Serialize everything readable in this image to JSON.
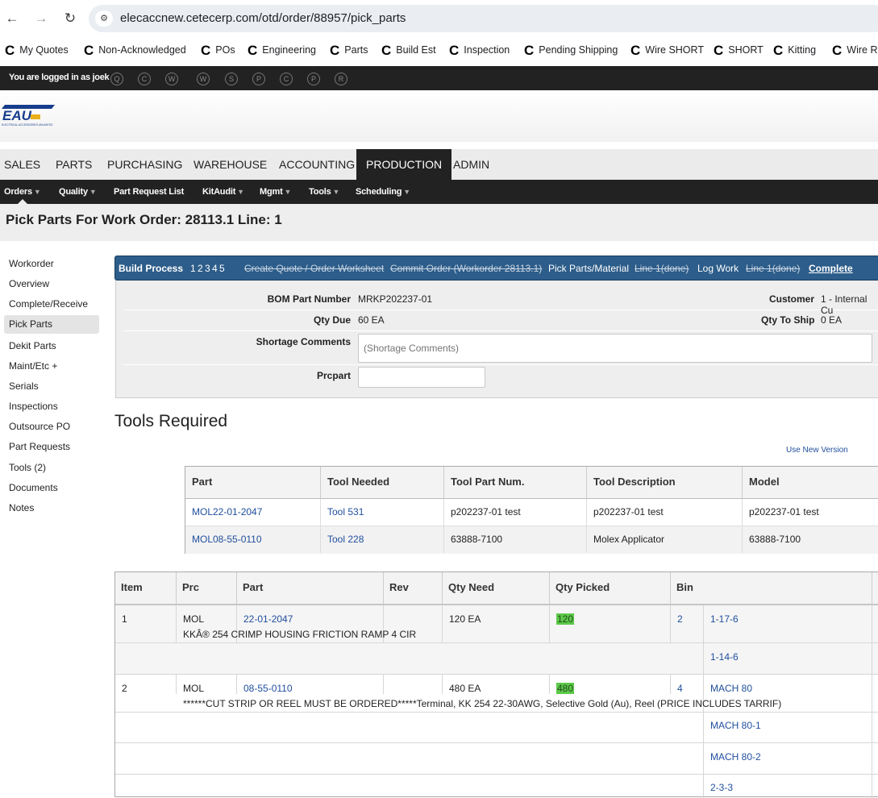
{
  "browser": {
    "url": "elecaccnew.cetecerp.com/otd/order/88957/pick_parts",
    "bookmarks": [
      "My Quotes",
      "Non-Acknowledged",
      "POs",
      "Engineering",
      "Parts",
      "Build Est",
      "Inspection",
      "Pending Shipping",
      "Wire SHORT",
      "SHORT",
      "Kitting",
      "Wire Re"
    ]
  },
  "topbar": {
    "logged_in_text": "You are logged in as joek",
    "quick_icons": [
      "Q",
      "C",
      "W",
      "W",
      "S",
      "P",
      "C",
      "P",
      "R"
    ]
  },
  "logo": {
    "text": "EAU",
    "subtext": "ELECTRICAL ACCESSORIES UNLIMITED"
  },
  "main_nav": [
    "SALES",
    "PARTS",
    "PURCHASING",
    "WAREHOUSE",
    "ACCOUNTING",
    "PRODUCTION",
    "ADMIN"
  ],
  "sub_nav": [
    {
      "label": "Orders",
      "caret": "▼"
    },
    {
      "label": "Quality",
      "caret": "▼"
    },
    {
      "label": "Part Request List",
      "caret": ""
    },
    {
      "label": "KitAudit",
      "caret": "▼"
    },
    {
      "label": "Mgmt",
      "caret": "▼"
    },
    {
      "label": "Tools",
      "caret": "▼"
    },
    {
      "label": "Scheduling",
      "caret": "▼"
    }
  ],
  "page_title": "Pick Parts For Work Order: 28113.1 Line: 1",
  "sidebar": [
    "Workorder",
    "Overview",
    "Complete/Receive",
    "Pick Parts",
    "Dekit Parts",
    "Maint/Etc +",
    "Serials",
    "Inspections",
    "Outsource PO",
    "Part Requests",
    "Tools (2)",
    "Documents",
    "Notes"
  ],
  "build_process": {
    "label": "Build Process",
    "steps": [
      "1",
      "2",
      "3",
      "4",
      "5"
    ],
    "create_quote": "Create Quote / Order Worksheet",
    "commit_order": "Commit Order (Workorder 28113.1)",
    "pick_parts": "Pick Parts/Material",
    "line1_a": "Line 1(done)",
    "log_work": "Log Work",
    "line1_b": "Line 1(done)",
    "complete": "Complete"
  },
  "info": {
    "bom_label": "BOM Part Number",
    "bom_value": "MRKP202237-01",
    "customer_label": "Customer",
    "customer_value": "1 - Internal Cu",
    "qty_due_label": "Qty Due",
    "qty_due_value": "60 EA",
    "qty_ship_label": "Qty To Ship",
    "qty_ship_value": "0 EA",
    "shortage_label": "Shortage Comments",
    "shortage_placeholder": "(Shortage Comments)",
    "prcpart_label": "Prcpart",
    "prcpart_value": ""
  },
  "tools_title": "Tools Required",
  "use_new_version": "Use New Version",
  "tools_table": {
    "headers": [
      "Part",
      "Tool Needed",
      "Tool Part Num.",
      "Tool Description",
      "Model"
    ],
    "rows": [
      [
        "MOL22-01-2047",
        "Tool 531",
        "p202237-01 test",
        "p202237-01 test",
        "p202237-01 test"
      ],
      [
        "MOL08-55-0110",
        "Tool 228",
        "63888-7100",
        "Molex Applicator",
        "63888-7100"
      ]
    ]
  },
  "parts_table": {
    "headers": [
      "Item",
      "Prc",
      "Part",
      "Rev",
      "Qty Need",
      "Qty Picked",
      "Bin"
    ],
    "items": [
      {
        "item": "1",
        "prc": "MOL",
        "part": "22-01-2047",
        "rev": "",
        "qty_need": "120 EA",
        "qty_picked": "120",
        "bin_count": "2",
        "description": "KKÂ® 254 CRIMP HOUSING FRICTION RAMP 4 CIR",
        "bins": [
          "1-17-6",
          "1-14-6"
        ]
      },
      {
        "item": "2",
        "prc": "MOL",
        "part": "08-55-0110",
        "rev": "",
        "qty_need": "480 EA",
        "qty_picked": "480",
        "bin_count": "4",
        "description": "******CUT STRIP OR REEL MUST BE ORDERED*****Terminal, KK 254 22-30AWG, Selective Gold (Au), Reel (PRICE INCLUDES TARRIF)",
        "bins": [
          "MACH 80",
          "MACH 80-1",
          "MACH 80-2",
          "2-3-3"
        ]
      }
    ]
  }
}
